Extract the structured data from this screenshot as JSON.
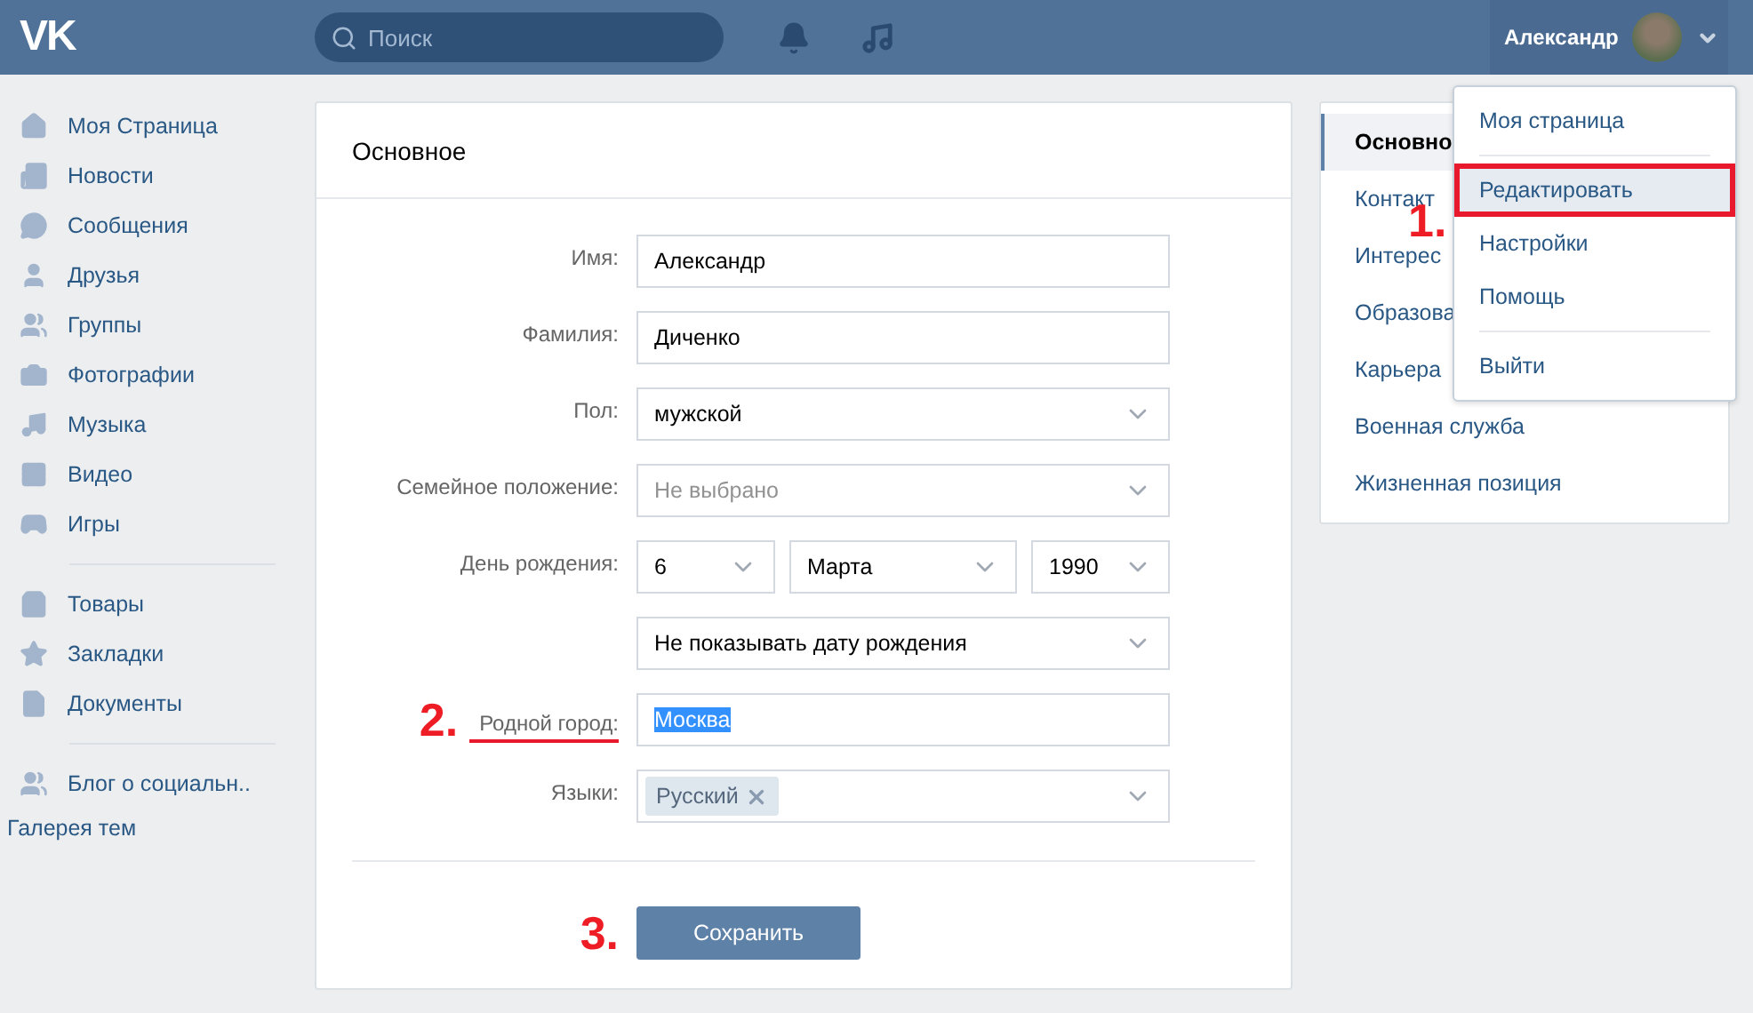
{
  "header": {
    "logo": "VK",
    "search": {
      "placeholder": "Поиск"
    },
    "user": {
      "name": "Александр"
    }
  },
  "sidebar": {
    "groups": [
      [
        {
          "label": "Моя Страница"
        },
        {
          "label": "Новости"
        },
        {
          "label": "Сообщения"
        },
        {
          "label": "Друзья"
        },
        {
          "label": "Группы"
        },
        {
          "label": "Фотографии"
        },
        {
          "label": "Музыка"
        },
        {
          "label": "Видео"
        },
        {
          "label": "Игры"
        }
      ],
      [
        {
          "label": "Товары"
        },
        {
          "label": "Закладки"
        },
        {
          "label": "Документы"
        }
      ],
      [
        {
          "label": "Блог о социальн.."
        }
      ]
    ],
    "footer_link": "Галерея тем"
  },
  "card": {
    "title": "Основное",
    "fields": [
      {
        "kind": "input",
        "label": "Имя:",
        "value": "Александр",
        "text_selected": false,
        "underlined": false
      },
      {
        "kind": "input",
        "label": "Фамилия:",
        "value": "Диченко",
        "text_selected": false,
        "underlined": false
      },
      {
        "kind": "select",
        "label": "Пол:",
        "value": "мужской"
      },
      {
        "kind": "select",
        "label": "Семейное положение:",
        "placeholder": "Не выбрано"
      },
      {
        "kind": "date",
        "label": "День рождения:",
        "day": "6",
        "month": "Марта",
        "year": "1990"
      },
      {
        "kind": "select",
        "value": "Не показывать дату рождения"
      },
      {
        "kind": "input",
        "label": "Родной город:",
        "value": "Москва",
        "text_selected": true,
        "underlined": true,
        "annotation": "2."
      },
      {
        "kind": "tags",
        "label": "Языки:",
        "tags": [
          "Русский"
        ]
      }
    ],
    "save_button": {
      "label": "Сохранить",
      "annotation": "3."
    }
  },
  "side_menu": [
    {
      "label": "Основно",
      "selected": true
    },
    {
      "label": "Контакт",
      "selected": false
    },
    {
      "label": "Интерес",
      "selected": false
    },
    {
      "label": "Образова",
      "selected": false
    },
    {
      "label": "Карьера",
      "selected": false
    },
    {
      "label": "Военная служба",
      "selected": false
    },
    {
      "label": "Жизненная позиция",
      "selected": false
    }
  ],
  "dropdown": {
    "annotation": "1.",
    "items": [
      {
        "label": "Моя страница",
        "separator_before": false,
        "highlighted": false
      },
      {
        "label": "Редактировать",
        "separator_before": true,
        "highlighted": true
      },
      {
        "label": "Настройки",
        "separator_before": false,
        "highlighted": false
      },
      {
        "label": "Помощь",
        "separator_before": false,
        "highlighted": false
      },
      {
        "label": "Выйти",
        "separator_before": true,
        "highlighted": false
      }
    ]
  }
}
